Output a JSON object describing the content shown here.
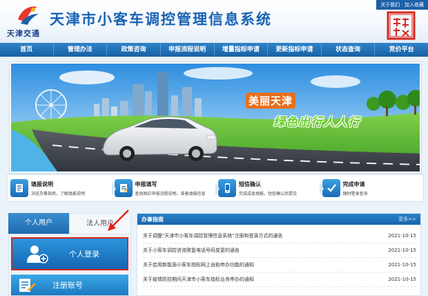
{
  "header": {
    "logo_text": "天津交通",
    "title": "天津市小客车调控管理信息系统",
    "links": "关于我们 · 加入收藏"
  },
  "nav": [
    {
      "label": "首页"
    },
    {
      "label": "管理办法"
    },
    {
      "label": "政策咨询"
    },
    {
      "label": "申报流程说明"
    },
    {
      "label": "增量指标申请"
    },
    {
      "label": "更新指标申请"
    },
    {
      "label": "状态查询"
    },
    {
      "label": "竞价平台"
    }
  ],
  "banner": {
    "headline": "美丽天津",
    "slogan": "绿色出行人人行"
  },
  "steps": [
    {
      "title": "填报说明",
      "desc": "浏览办事指南，了解填报说明",
      "icon": "document-icon"
    },
    {
      "title": "申报填写",
      "desc": "查阅相应申报流程说明，准备填报信息",
      "icon": "form-icon"
    },
    {
      "title": "短信确认",
      "desc": "完成成息填报，短信确认后提交",
      "icon": "phone-icon"
    },
    {
      "title": "完成申请",
      "desc": "随时登录查询",
      "icon": "checkmark-icon"
    }
  ],
  "login": {
    "tab_personal": "个人用户",
    "tab_company": "法人用户",
    "login_label": "个人登录",
    "register_label": "注册账号"
  },
  "notices": {
    "title": "办事指南",
    "more": "更多>>",
    "items": [
      {
        "title": "关于调整\"天津市小客车调控管理信息系统\"注册和登录方式的通告",
        "date": "2021-10-15"
      },
      {
        "title": "关于小客车调控咨询答复电话号码变更的通告",
        "date": "2021-10-15"
      },
      {
        "title": "关于启用新能源小客车指标网上自助申办功能的通知",
        "date": "2021-10-15"
      },
      {
        "title": "关于疫情防控期间天津市小客车指标业务申办的通知",
        "date": "2021-10-15"
      }
    ]
  },
  "colors": {
    "primary": "#1a63b4",
    "nav": "#1761a6",
    "highlight": "#e0231a",
    "green": "#6ccf2c"
  }
}
